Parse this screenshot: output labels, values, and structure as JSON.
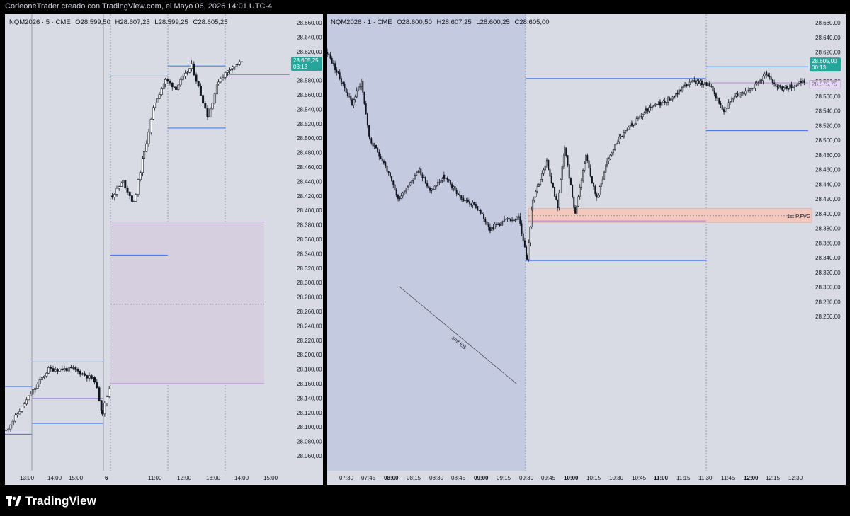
{
  "header": {
    "text": "CorleoneTrader creado con TradingView.com, el Mayo 06, 2026 14:01 UTC-4"
  },
  "footer": {
    "brand": "TradingView"
  },
  "colors": {
    "bg": "#d8dbe3",
    "session_shade": "#c4cadf",
    "blue_line": "#4a7cf0",
    "purple_line": "#b07fc9",
    "fvg_fill": "#f2c8bf",
    "candle": "#131722",
    "price_tag": "#26a69a"
  },
  "left": {
    "symbol": "NQM2026 · 5 · CME",
    "open": "O28.599,50",
    "high": "H28.607,25",
    "low": "L28.599,25",
    "close": "C28.605,25",
    "price_tag": "28.605,25",
    "countdown": "03:13",
    "y_ticks": [
      "28.660,00",
      "28.640,00",
      "28.620,00",
      "28.600,00",
      "28.580,00",
      "28.560,00",
      "28.540,00",
      "28.520,00",
      "28.500,00",
      "28.480,00",
      "28.460,00",
      "28.440,00",
      "28.420,00",
      "28.400,00",
      "28.380,00",
      "28.360,00",
      "28.340,00",
      "28.320,00",
      "28.300,00",
      "28.280,00",
      "28.260,00",
      "28.240,00",
      "28.220,00",
      "28.200,00",
      "28.180,00",
      "28.160,00",
      "28.140,00",
      "28.120,00",
      "28.100,00",
      "28.080,00",
      "28.060,00"
    ],
    "x_ticks": [
      "13:00",
      "14:00",
      "15:00",
      "6",
      "11:00",
      "12:00",
      "13:00",
      "14:00",
      "15:00"
    ],
    "x_bold": [
      "6"
    ]
  },
  "right": {
    "symbol": "NQM2026 · 1 · CME",
    "open": "O28.600,50",
    "high": "H28.607,25",
    "low": "L28.600,25",
    "close": "C28.605,00",
    "price_tag": "28.605,00",
    "countdown": "00:13",
    "secondary_tag": "28.575,75",
    "fvg_label": "1st P.FVG",
    "trendline_label": "smt ES",
    "y_ticks": [
      "28.660,00",
      "28.640,00",
      "28.620,00",
      "28.600,00",
      "28.580,00",
      "28.560,00",
      "28.540,00",
      "28.520,00",
      "28.500,00",
      "28.480,00",
      "28.460,00",
      "28.440,00",
      "28.420,00",
      "28.400,00",
      "28.380,00",
      "28.360,00",
      "28.340,00",
      "28.320,00",
      "28.300,00",
      "28.280,00",
      "28.260,00"
    ],
    "x_ticks": [
      "07:30",
      "07:45",
      "08:00",
      "08:15",
      "08:30",
      "08:45",
      "09:00",
      "09:15",
      "09:30",
      "09:45",
      "10:00",
      "10:15",
      "10:30",
      "10:45",
      "11:00",
      "11:15",
      "11:30",
      "11:45",
      "12:00",
      "12:15",
      "12:30"
    ],
    "x_bold": [
      "08:00",
      "09:00",
      "10:00",
      "11:00",
      "12:00"
    ]
  }
}
